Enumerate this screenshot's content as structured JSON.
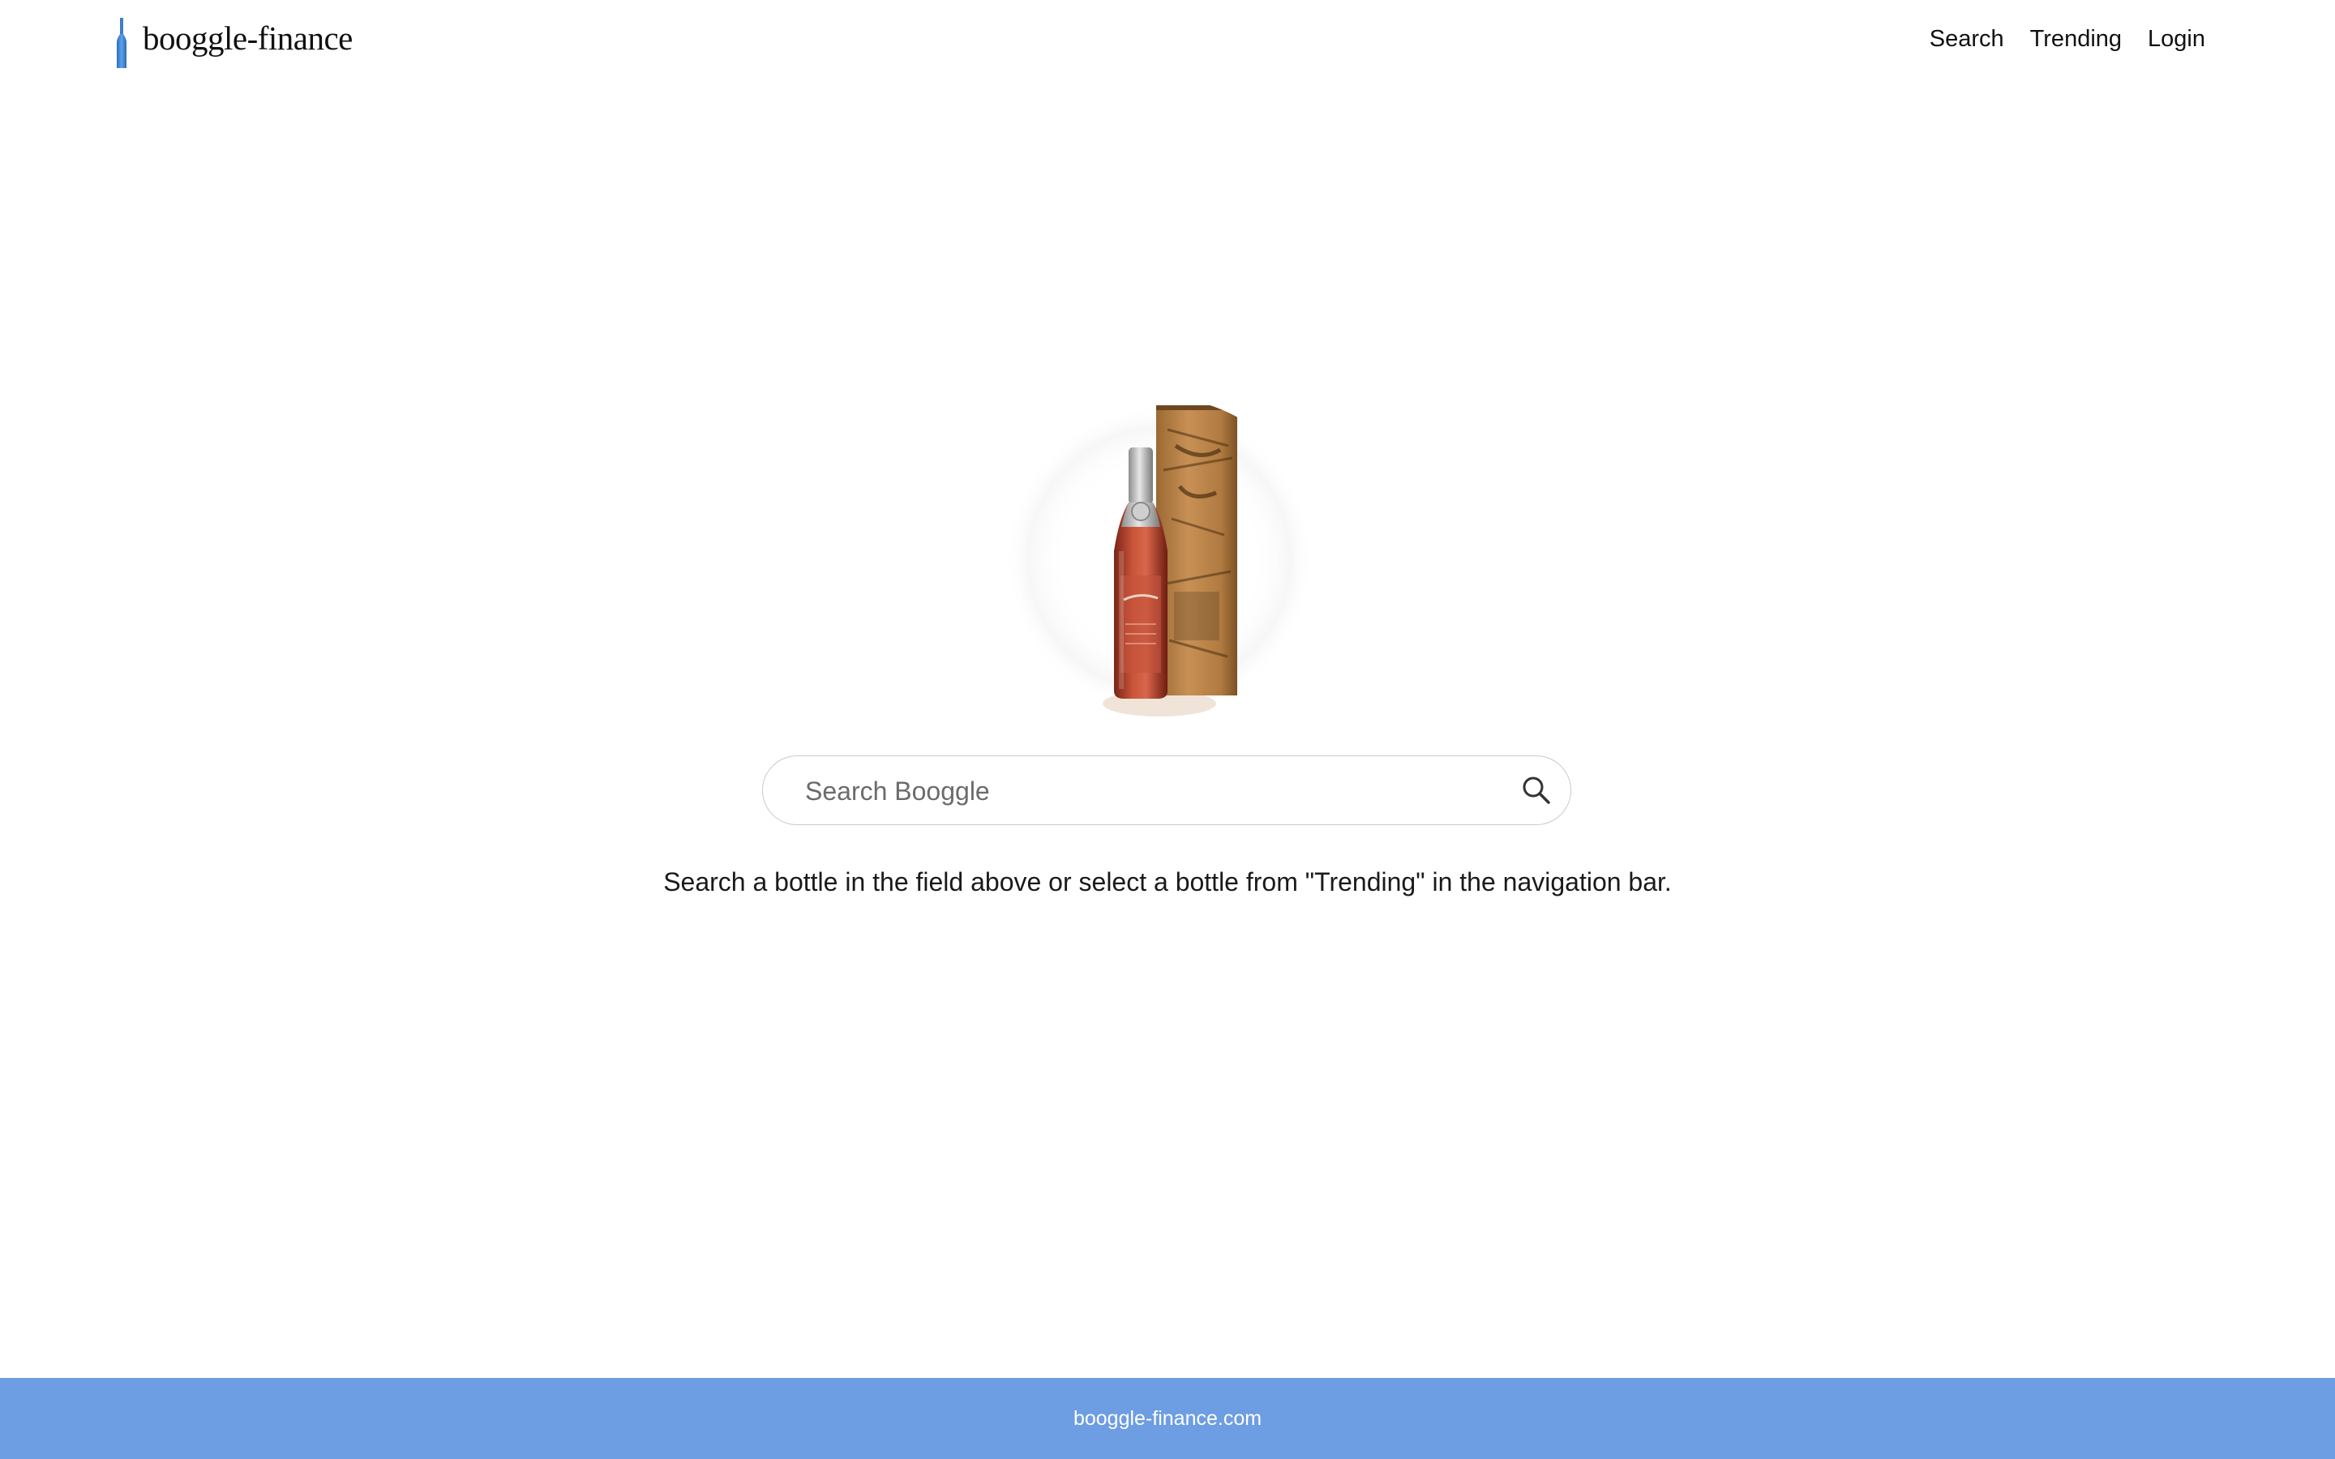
{
  "header": {
    "brand": "booggle-finance",
    "nav": [
      "Search",
      "Trending",
      "Login"
    ]
  },
  "hero": {
    "image": "whiskey-bottle-with-wooden-box"
  },
  "search": {
    "placeholder": "Search Booggle",
    "value": "",
    "icon": "search-icon"
  },
  "helper_text": "Search a bottle in the field above or select a bottle from \"Trending\" in the navigation bar.",
  "footer": {
    "text": "booggle-finance.com"
  },
  "colors": {
    "footer_bg": "#6d9de2",
    "logo_blue": "#4a90d9"
  }
}
